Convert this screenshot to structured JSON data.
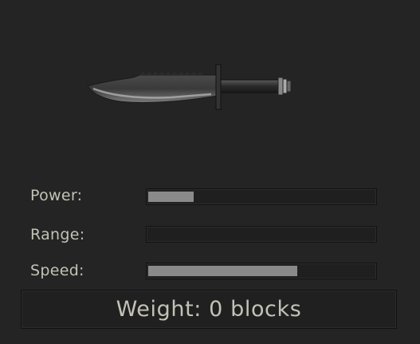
{
  "weapon": {
    "icon": "combat-knife-icon"
  },
  "stats": [
    {
      "label": "Power:",
      "value": 0.2
    },
    {
      "label": "Range:",
      "value": 0.0
    },
    {
      "label": "Speed:",
      "value": 0.66
    }
  ],
  "weight": {
    "text": "Weight: 0 blocks"
  },
  "colors": {
    "background": "#242424",
    "bar_fill": "#8a8a8a",
    "text": "#c2c2b6"
  }
}
